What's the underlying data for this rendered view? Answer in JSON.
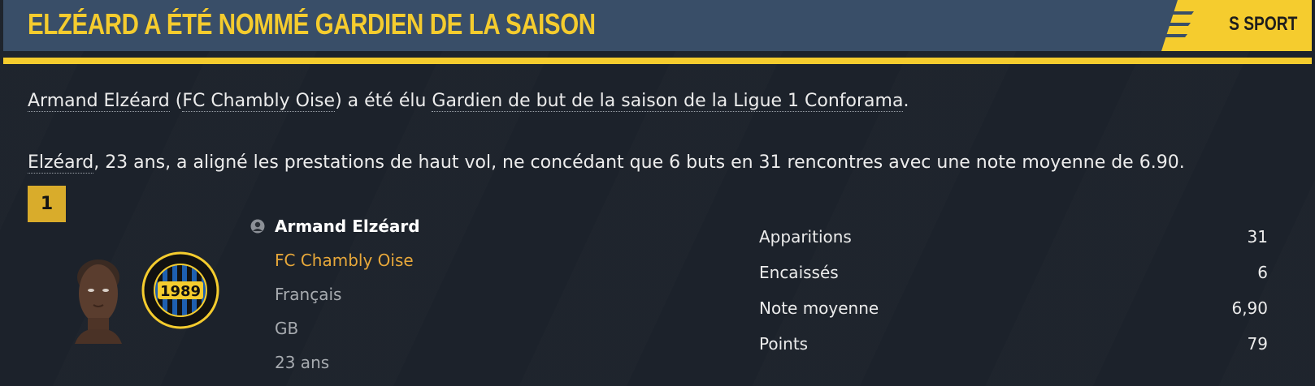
{
  "header": {
    "title": "ELZÉARD A ÉTÉ NOMMÉ GARDIEN DE LA SAISON",
    "brand": "S SPORT"
  },
  "article": {
    "p1": {
      "player": "Armand Elzéard",
      "club": "FC Chambly Oise",
      "mid": " a été élu ",
      "award": "Gardien de but de la saison de la Ligue 1 Conforama",
      "end": "."
    },
    "p2": {
      "player": "Elzéard",
      "rest": ", 23 ans, a aligné les prestations de haut vol, ne concédant que 6 buts en 31 rencontres avec une note moyenne de 6.90."
    }
  },
  "card": {
    "rank": "1",
    "name": "Armand Elzéard",
    "club": "FC Chambly Oise",
    "nationality": "Français",
    "position": "GB",
    "age": "23 ans",
    "badge_year": "1989"
  },
  "stats": [
    {
      "label": "Apparitions",
      "value": "31"
    },
    {
      "label": "Encaissés",
      "value": "6"
    },
    {
      "label": "Note moyenne",
      "value": "6,90"
    },
    {
      "label": "Points",
      "value": "79"
    }
  ],
  "colors": {
    "accent": "#f5cc2e",
    "header_bg": "#394e68",
    "page_bg": "#1c222b",
    "club_text": "#e8a83a",
    "rank_bg": "#d9ac2b"
  }
}
